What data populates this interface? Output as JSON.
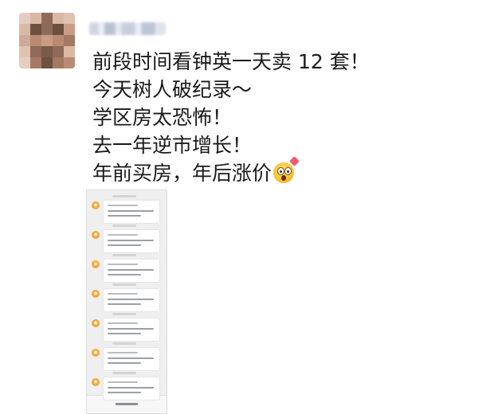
{
  "post": {
    "lines": [
      "前段时间看钟英一天卖 12 套！",
      "今天树人破纪录～",
      "学区房太恐怖！",
      "去一年逆市增长！",
      "年前买房，年后涨价"
    ],
    "emoji": "fearful-face-emoji"
  },
  "colors": {
    "text": "#1a1a1a",
    "screenshot_bg": "#efefef",
    "notification_icon": "#f3a73a"
  },
  "avatar": {
    "icon": "pixelated-avatar"
  },
  "embedded_screenshot": {
    "icon": "notification-list-screenshot",
    "message_count": 7
  }
}
